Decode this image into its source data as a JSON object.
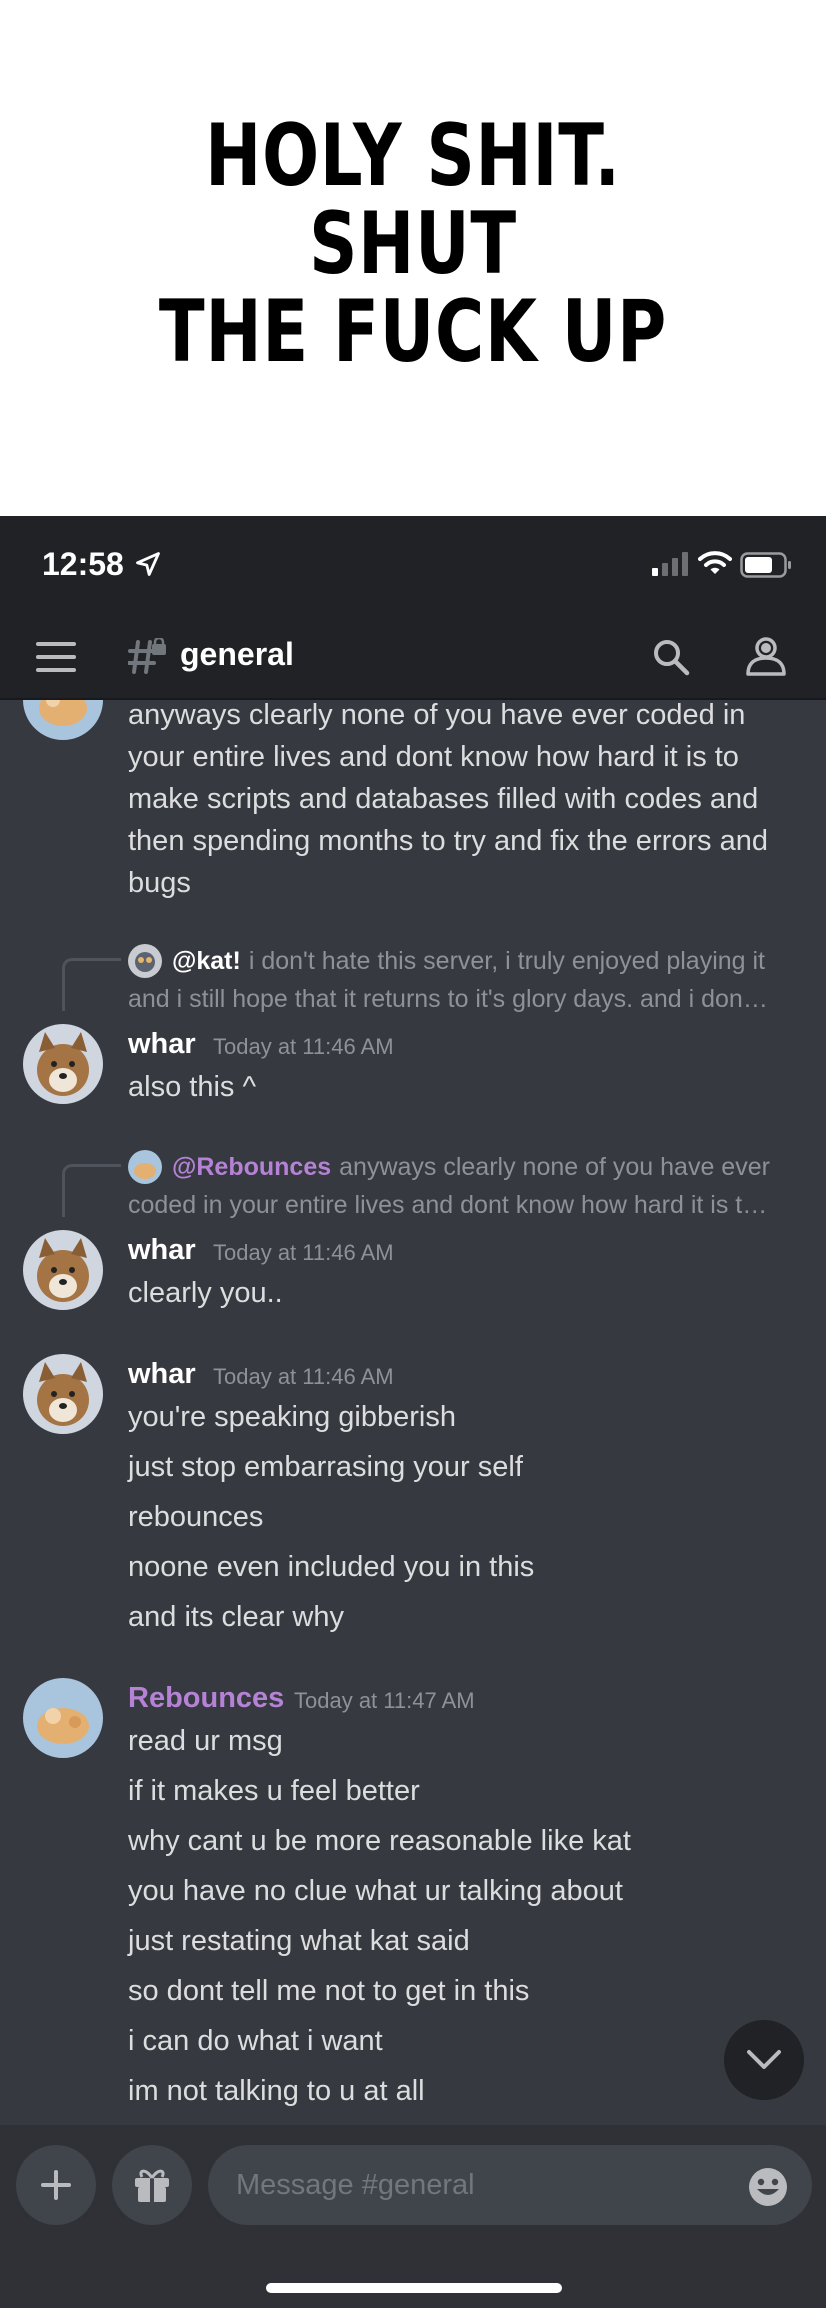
{
  "meme": {
    "text": "HOLY SHIT. SHUT\nTHE FUCK UP"
  },
  "status_bar": {
    "time": "12:58"
  },
  "header": {
    "channel_name": "general"
  },
  "messages": [
    {
      "lines": [
        "anyways clearly none of you have ever coded in your entire lives and dont know how hard it is to make scripts and databases filled with codes and then spending months to try and fix the errors and bugs"
      ]
    },
    {
      "reply": {
        "mention": "@kat!",
        "text": "i don't hate this server, i truly enjoyed playing it and i still hope that it returns to it's glory days. and i don…",
        "text_line1": "i don't hate this server, i truly enjoyed playing it",
        "text_line2": "and i still hope that it returns to it's glory days. and i don…"
      },
      "username": "whar",
      "timestamp": "Today at 11:46 AM",
      "lines": [
        "also this ^"
      ]
    },
    {
      "reply": {
        "mention": "@Rebounces",
        "text_line1": "anyways clearly none of you have ever",
        "text_line2": "coded in your entire lives and dont know how hard it is t…"
      },
      "username": "whar",
      "timestamp": "Today at 11:46 AM",
      "lines": [
        "clearly you.."
      ]
    },
    {
      "username": "whar",
      "timestamp": "Today at 11:46 AM",
      "lines": [
        "you're speaking gibberish",
        "just stop embarrasing your self",
        "rebounces",
        "noone even included you in this",
        "and its clear why"
      ]
    },
    {
      "username": "Rebounces",
      "timestamp": "Today at 11:47 AM",
      "lines": [
        "read ur msg",
        "if it makes u feel better",
        "why cant u be more reasonable like kat",
        "you have no clue what ur talking about",
        "just restating what kat said",
        "so dont tell me not to get in this",
        "i can do what i want",
        "im not talking to u at all"
      ]
    }
  ],
  "composer": {
    "placeholder": "Message #general"
  },
  "colors": {
    "background": "#36393f",
    "header": "#202225",
    "rebounces_name": "#b582d6"
  }
}
